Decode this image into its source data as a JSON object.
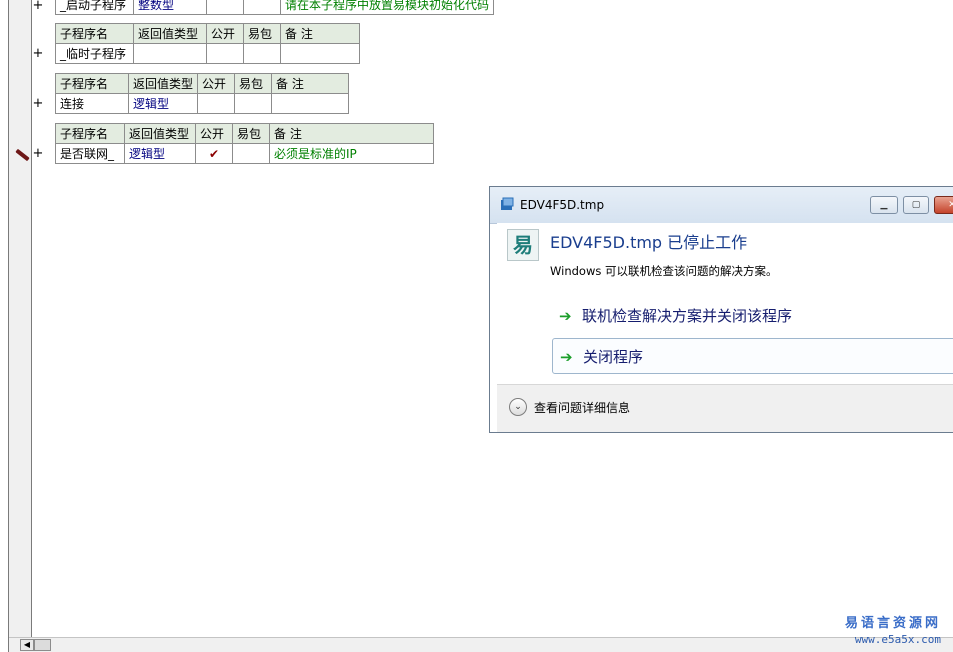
{
  "subroutines": [
    {
      "header": null,
      "row": [
        "_启动子程序",
        "整数型",
        "",
        "",
        "请在本子程序中放置易模块初始化代码"
      ]
    },
    {
      "header": [
        "子程序名",
        "返回值类型",
        "公开",
        "易包",
        "备 注"
      ],
      "row": [
        "_临时子程序",
        "",
        "",
        "",
        ""
      ]
    },
    {
      "header": [
        "子程序名",
        "返回值类型",
        "公开",
        "易包",
        "备 注"
      ],
      "row": [
        "连接",
        "逻辑型",
        "",
        "",
        ""
      ]
    },
    {
      "header": [
        "子程序名",
        "返回值类型",
        "公开",
        "易包",
        "备 注"
      ],
      "row": [
        "是否联网_",
        "逻辑型",
        "✔",
        "",
        "必须是标准的IP"
      ]
    }
  ],
  "expand_symbol": "+",
  "dialog": {
    "title": "EDV4F5D.tmp",
    "app_icon_glyph": "易",
    "heading": "EDV4F5D.tmp 已停止工作",
    "subtext": "Windows 可以联机检查该问题的解决方案。",
    "options": [
      "联机检查解决方案并关闭该程序",
      "关闭程序"
    ],
    "details_label": "查看问题详细信息"
  },
  "watermark": {
    "title": "易语言资源网",
    "url": "www.e5a5x.com"
  },
  "colors": {
    "header_bg": "#e3ece0",
    "type_text": "#000080",
    "remark_text": "#008000",
    "dialog_heading": "#1a3e8e",
    "command_arrow": "#1b9e2a"
  }
}
